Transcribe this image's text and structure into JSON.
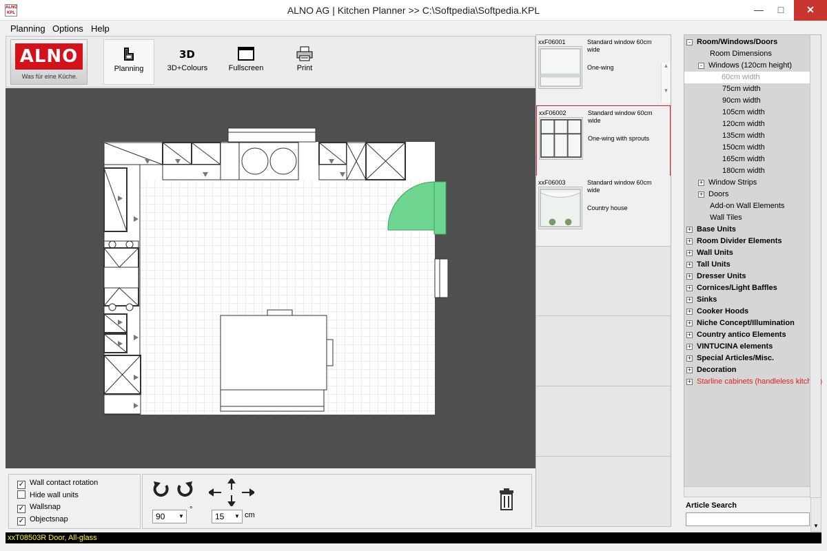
{
  "window": {
    "title": "ALNO AG | Kitchen Planner  >>  C:\\Softpedia\\Softpedia.KPL",
    "icon_text": "ALNO KPL"
  },
  "menu": [
    "Planning",
    "Options",
    "Help"
  ],
  "toolbar": {
    "logo_text": "ALNO",
    "logo_sub": "Was für eine Küche.",
    "tools": [
      {
        "label": "Planning",
        "icon": "planning-icon"
      },
      {
        "label": "3D+Colours",
        "icon": "3d-icon"
      },
      {
        "label": "Fullscreen",
        "icon": "fullscreen-icon"
      },
      {
        "label": "Print",
        "icon": "printer-icon"
      }
    ]
  },
  "options": {
    "checkboxes": [
      {
        "label": "Wall contact rotation",
        "checked": true
      },
      {
        "label": "Hide wall units",
        "checked": false
      },
      {
        "label": "Wallsnap",
        "checked": true
      },
      {
        "label": "Objectsnap",
        "checked": true
      }
    ],
    "rotation_value": "90",
    "rotation_unit": "°",
    "step_value": "15",
    "step_unit": "cm"
  },
  "status": "xxT08503R Door, All-glass",
  "articles": [
    {
      "code": "xxF06001",
      "name": "Standard window 60cm wide",
      "desc": "One-wing",
      "selected": false
    },
    {
      "code": "xxF06002",
      "name": "Standard window 60cm wide",
      "desc": "One-wing with sprouts",
      "selected": true
    },
    {
      "code": "xxF06003",
      "name": "Standard window 60cm wide",
      "desc": "Country house",
      "selected": false
    }
  ],
  "tree": [
    {
      "label": "Room/Windows/Doors",
      "level": 0,
      "exp": "-",
      "bold": true
    },
    {
      "label": "Room Dimensions",
      "level": 1,
      "exp": ""
    },
    {
      "label": "Windows (120cm height)",
      "level": 1,
      "exp": "-"
    },
    {
      "label": "60cm width",
      "level": 2,
      "exp": "",
      "selected": true
    },
    {
      "label": "75cm width",
      "level": 2,
      "exp": ""
    },
    {
      "label": "90cm width",
      "level": 2,
      "exp": ""
    },
    {
      "label": "105cm width",
      "level": 2,
      "exp": ""
    },
    {
      "label": "120cm width",
      "level": 2,
      "exp": ""
    },
    {
      "label": "135cm width",
      "level": 2,
      "exp": ""
    },
    {
      "label": "150cm width",
      "level": 2,
      "exp": ""
    },
    {
      "label": "165cm width",
      "level": 2,
      "exp": ""
    },
    {
      "label": "180cm width",
      "level": 2,
      "exp": ""
    },
    {
      "label": "Window Strips",
      "level": 1,
      "exp": "+"
    },
    {
      "label": "Doors",
      "level": 1,
      "exp": "+"
    },
    {
      "label": "Add-on Wall Elements",
      "level": 1,
      "exp": ""
    },
    {
      "label": "Wall Tiles",
      "level": 1,
      "exp": ""
    },
    {
      "label": "Base Units",
      "level": 0,
      "exp": "+",
      "bold": true
    },
    {
      "label": "Room Divider Elements",
      "level": 0,
      "exp": "+",
      "bold": true
    },
    {
      "label": "Wall Units",
      "level": 0,
      "exp": "+",
      "bold": true
    },
    {
      "label": "Tall Units",
      "level": 0,
      "exp": "+",
      "bold": true
    },
    {
      "label": "Dresser Units",
      "level": 0,
      "exp": "+",
      "bold": true
    },
    {
      "label": "Cornices/Light Baffles",
      "level": 0,
      "exp": "+",
      "bold": true
    },
    {
      "label": "Sinks",
      "level": 0,
      "exp": "+",
      "bold": true
    },
    {
      "label": "Cooker Hoods",
      "level": 0,
      "exp": "+",
      "bold": true
    },
    {
      "label": "Niche Concept/Illumination",
      "level": 0,
      "exp": "+",
      "bold": true
    },
    {
      "label": "Country antico Elements",
      "level": 0,
      "exp": "+",
      "bold": true
    },
    {
      "label": "VINTUCINA elements",
      "level": 0,
      "exp": "+",
      "bold": true
    },
    {
      "label": "Special Articles/Misc.",
      "level": 0,
      "exp": "+",
      "bold": true
    },
    {
      "label": "Decoration",
      "level": 0,
      "exp": "+",
      "bold": true
    },
    {
      "label": "Starline cabinets (handleless kitchen)",
      "level": 0,
      "exp": "+",
      "red": true
    }
  ],
  "search": {
    "label": "Article Search",
    "value": ""
  },
  "colors": {
    "canvas": "#4f4f4f",
    "door_green": "#6ed690",
    "status_text": "#ffff00",
    "highlight_red": "#e02020"
  }
}
